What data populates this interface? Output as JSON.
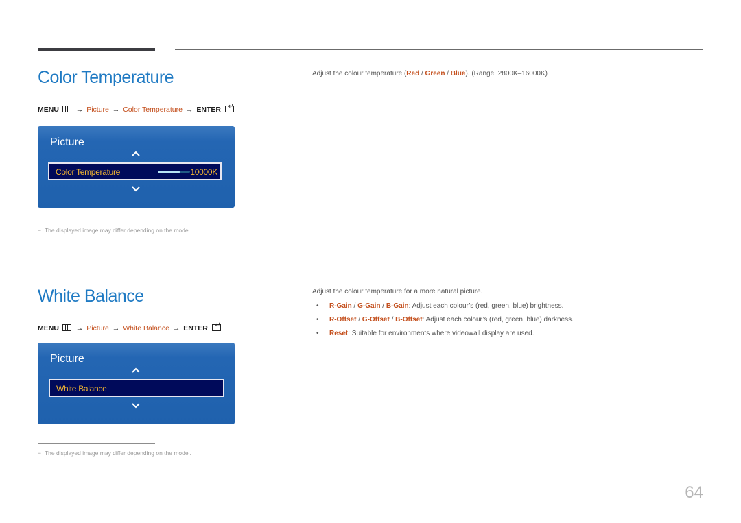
{
  "page_number": "64",
  "sections": {
    "color_temperature": {
      "title": "Color Temperature",
      "menu_path": {
        "menu": "MENU",
        "menu_icon": "menu-icon",
        "arrow": "→",
        "step1": "Picture",
        "step2": "Color Temperature",
        "enter": "ENTER",
        "enter_icon": "enter-icon"
      },
      "osd": {
        "title": "Picture",
        "up_icon": "chevron-up-icon",
        "down_icon": "chevron-down-icon",
        "item_label": "Color Temperature",
        "item_value": "10000K",
        "slider_fraction": 0.68
      },
      "footnote": {
        "dash": "−",
        "text": "The displayed image may differ depending on the model."
      },
      "description": {
        "prefix": "Adjust the colour temperature (",
        "red": "Red",
        "sep1": " / ",
        "green": "Green",
        "sep2": " / ",
        "blue": "Blue",
        "suffix": "). (Range: 2800K–16000K)"
      }
    },
    "white_balance": {
      "title": "White Balance",
      "menu_path": {
        "menu": "MENU",
        "arrow": "→",
        "step1": "Picture",
        "step2": "White Balance",
        "enter": "ENTER"
      },
      "osd": {
        "title": "Picture",
        "item_label": "White Balance"
      },
      "footnote": {
        "dash": "−",
        "text": "The displayed image may differ depending on the model."
      },
      "description": "Adjust the colour temperature for a more natural picture.",
      "bullets": [
        {
          "bullet": "•",
          "terms": [
            "R-Gain",
            "G-Gain",
            "B-Gain"
          ],
          "sep": " / ",
          "text": ": Adjust each colour’s (red, green, blue) brightness."
        },
        {
          "bullet": "•",
          "terms": [
            "R-Offset",
            "G-Offset",
            "B-Offset"
          ],
          "sep": " / ",
          "text": ": Adjust each colour’s (red, green, blue) darkness."
        },
        {
          "bullet": "•",
          "terms": [
            "Reset"
          ],
          "sep": "",
          "text": ": Suitable for environments where videowall display are used."
        }
      ]
    }
  },
  "colors": {
    "heading": "#1f7ac3",
    "highlight": "#c4501e",
    "osd_bg": "#2466b3",
    "osd_item_bg": "#000a5a",
    "osd_item_text": "#f2b632"
  }
}
